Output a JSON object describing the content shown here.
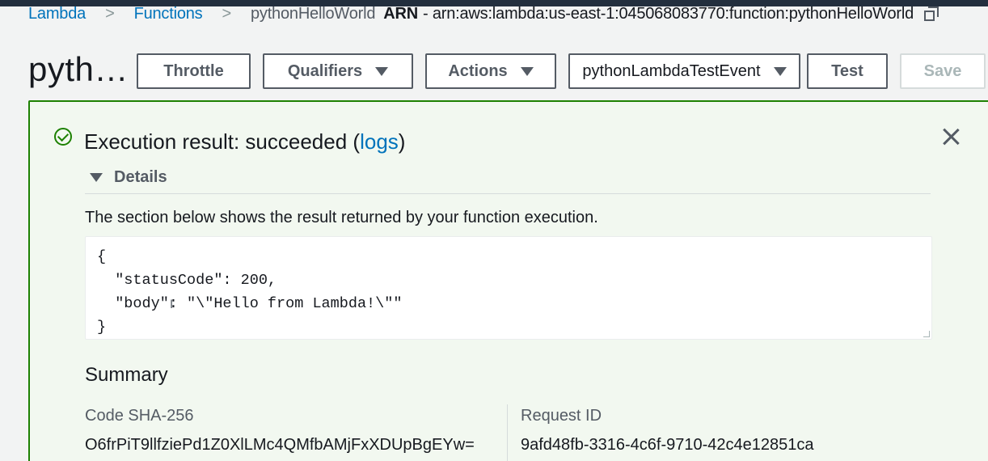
{
  "breadcrumb": {
    "items": [
      "Lambda",
      "Functions",
      "pythonHelloWorld"
    ],
    "arn_label": "ARN",
    "arn_value": "- arn:aws:lambda:us-east-1:045068083770:function:pythonHelloWorld"
  },
  "header": {
    "title": "pyth…",
    "buttons": {
      "throttle": "Throttle",
      "qualifiers": "Qualifiers",
      "actions": "Actions",
      "test_event": "pythonLambdaTestEvent",
      "test": "Test",
      "save": "Save"
    }
  },
  "result": {
    "title_prefix": "Execution result: succeeded (",
    "logs_link": "logs",
    "title_suffix": ")",
    "details_label": "Details",
    "description": "The section below shows the result returned by your function execution.",
    "code_lines": [
      "{",
      "  \"statusCode\": 200,",
      "  \"body\": \"\\\"Hello from Lambda!\\\"\"",
      "}"
    ]
  },
  "summary": {
    "heading": "Summary",
    "code_sha_label": "Code SHA-256",
    "code_sha_value": "O6frPiT9llfziePd1Z0XlLMc4QMfbAMjFxXDUpBgEYw=",
    "request_id_label": "Request ID",
    "request_id_value": "9afd48fb-3316-4c6f-9710-42c4e12851ca"
  },
  "colors": {
    "success": "#1d8102",
    "link": "#0073bb",
    "panel_bg": "#f2f8f0"
  }
}
